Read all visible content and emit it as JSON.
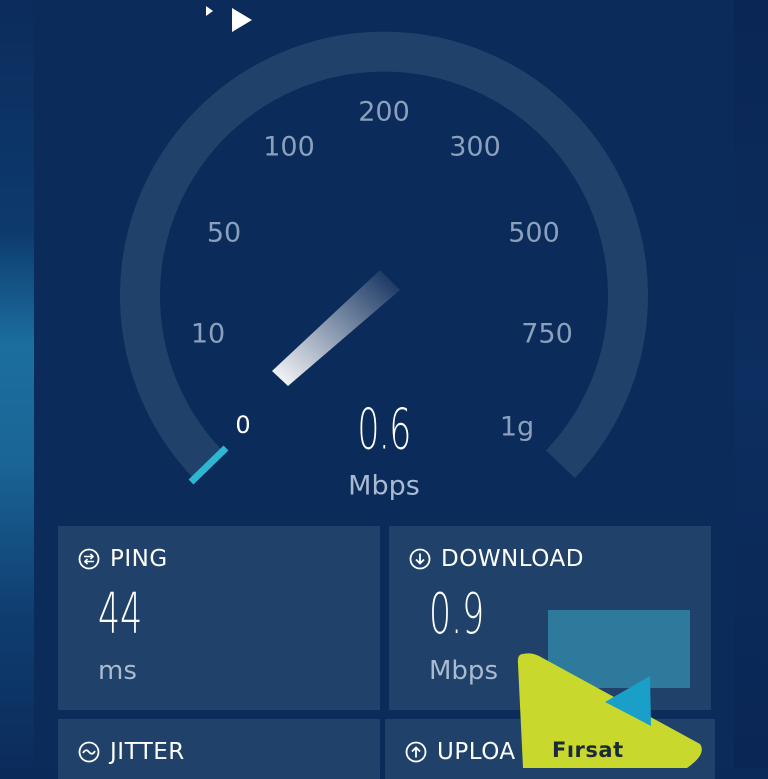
{
  "top": {
    "text": ""
  },
  "gauge": {
    "ticks": [
      "0",
      "10",
      "50",
      "100",
      "200",
      "300",
      "500",
      "750",
      "1g"
    ],
    "speed_value": "0.6",
    "speed_unit": "Mbps",
    "accent_color": "#2fb6d1",
    "track_color": "#1f416a"
  },
  "ping": {
    "title": "PING",
    "value": "44",
    "unit": "ms",
    "icon": "ping-icon"
  },
  "download": {
    "title": "DOWNLOAD",
    "value": "0.9",
    "unit": "Mbps",
    "icon": "download-icon"
  },
  "jitter": {
    "title": "JITTER",
    "icon": "jitter-icon"
  },
  "upload": {
    "title": "UPLOA",
    "icon": "upload-icon"
  },
  "promo": {
    "text": "Fırsat",
    "color": "#c9d82c",
    "play_color": "#1aa0c8"
  }
}
